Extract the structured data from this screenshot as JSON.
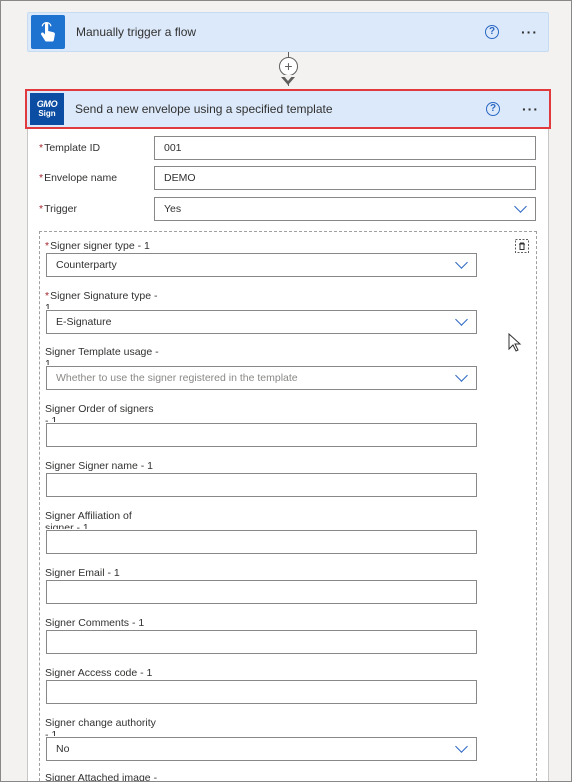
{
  "trigger": {
    "title": "Manually trigger a flow",
    "icon": "touch-hand-icon",
    "accent": "#1e73d1"
  },
  "connector": {
    "add_icon": "+"
  },
  "action": {
    "title": "Send a new envelope using a specified template",
    "logo_line1": "GMO",
    "logo_line2": "Sign",
    "logo_color": "#0a4da2",
    "highlight_color": "#e03a3e"
  },
  "help_glyph": "?",
  "more_glyph": "···",
  "required_marker": "*",
  "fields": {
    "template_id": {
      "label": "Template ID",
      "value": "001"
    },
    "envelope_name": {
      "label": "Envelope name",
      "value": "DEMO"
    },
    "trigger": {
      "label": "Trigger",
      "value": "Yes"
    }
  },
  "signer": {
    "signer_type": {
      "label": "Signer signer type - 1",
      "value": "Counterparty"
    },
    "signature_type": {
      "label_line1": "Signer Signature type -",
      "label_line2": "1",
      "value": "E-Signature"
    },
    "template_usage": {
      "label_line1": "Signer Template usage -",
      "label_line2": "1",
      "placeholder": "Whether to use the signer registered in the template"
    },
    "order": {
      "label_line1": "Signer Order of signers",
      "label_line2": "- 1",
      "value": ""
    },
    "name": {
      "label": "Signer Signer name - 1",
      "value": ""
    },
    "affiliation": {
      "label_line1": "Signer Affiliation of",
      "label_line2": "signer - 1",
      "value": ""
    },
    "email": {
      "label": "Signer Email - 1",
      "value": ""
    },
    "comments": {
      "label": "Signer Comments - 1",
      "value": ""
    },
    "access_code": {
      "label": "Signer Access code - 1",
      "value": ""
    },
    "change_authority": {
      "label_line1": "Signer change authority",
      "label_line2": "- 1",
      "value": "No"
    },
    "attached_image": {
      "label": "Signer Attached image -"
    }
  }
}
